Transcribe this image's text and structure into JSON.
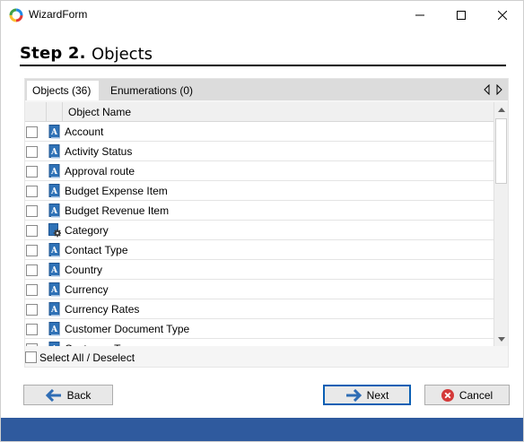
{
  "window": {
    "title": "WizardForm"
  },
  "step": {
    "number": "Step 2.",
    "title": "Objects"
  },
  "tabs": [
    {
      "label": "Objects (36)",
      "active": true
    },
    {
      "label": "Enumerations (0)",
      "active": false
    }
  ],
  "grid": {
    "column_header": "Object Name",
    "rows": [
      {
        "label": "Account",
        "icon": "document-a-icon"
      },
      {
        "label": "Activity Status",
        "icon": "document-a-icon"
      },
      {
        "label": "Approval route",
        "icon": "document-a-icon"
      },
      {
        "label": "Budget Expense Item",
        "icon": "document-a-icon"
      },
      {
        "label": "Budget Revenue Item",
        "icon": "document-a-icon"
      },
      {
        "label": "Category",
        "icon": "book-gear-icon"
      },
      {
        "label": "Contact Type",
        "icon": "document-a-icon"
      },
      {
        "label": "Country",
        "icon": "document-a-icon"
      },
      {
        "label": "Currency",
        "icon": "document-a-icon"
      },
      {
        "label": "Currency Rates",
        "icon": "document-a-icon"
      },
      {
        "label": "Customer Document Type",
        "icon": "document-a-icon"
      },
      {
        "label": "Customer Type",
        "icon": "document-a-icon"
      }
    ]
  },
  "select_all": {
    "label": "Select All / Deselect"
  },
  "buttons": {
    "back": "Back",
    "next": "Next",
    "cancel": "Cancel"
  },
  "colors": {
    "footer": "#2f5a9e",
    "icon_blue": "#2f72b7",
    "cancel_red": "#d43a3a",
    "arrow_blue": "#2f6db5"
  }
}
